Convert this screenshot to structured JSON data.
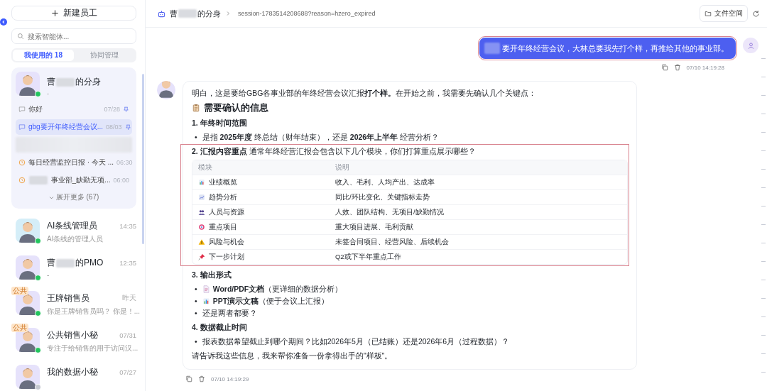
{
  "sidebar": {
    "new_button": "新建员工",
    "search": {
      "placeholder": "搜索智能体..."
    },
    "tabs": [
      {
        "label": "我使用的",
        "count": "18",
        "selected": true
      },
      {
        "label": "协同管理",
        "selected": false
      }
    ],
    "current_agent": {
      "name": [
        "曹",
        "的分身"
      ],
      "subtitle": "-",
      "online": true,
      "sessions": [
        {
          "kind": "chat",
          "title": "你好",
          "time": "07/28",
          "pinned": true,
          "selected": false,
          "redacted": false
        },
        {
          "kind": "chat",
          "title": "gbg要开年终经营会议...",
          "time": "08/03",
          "pinned": true,
          "selected": true,
          "redacted": false
        },
        {
          "kind": "hidden"
        },
        {
          "kind": "scheduled",
          "title": "每日经营监控日报 · 今天 ...",
          "time": "06:30",
          "selected": false,
          "redacted": false
        },
        {
          "kind": "scheduled",
          "title": "事业部_缺勤无项...",
          "time": "06:00",
          "selected": false,
          "redacted": true
        }
      ],
      "expand": "展开更多 (67)"
    },
    "agents": [
      {
        "name": [
          "AI条线管理员"
        ],
        "desc": "AI条线的管理人员",
        "time": "14:35",
        "online": true,
        "color": "#d5eef8"
      },
      {
        "name": [
          "曹",
          "的PMO"
        ],
        "desc": "-",
        "time": "12:35",
        "online": true,
        "color": "#e6e2fb"
      },
      {
        "name": [
          "王牌销售员"
        ],
        "desc": "你是王牌销售员吗？ 你是！...",
        "time": "昨天",
        "tag": "公共",
        "online": true,
        "color": "#e6e2fb"
      },
      {
        "name": [
          "公共销售小秘"
        ],
        "desc": "专注于给销售的用于访问汉...",
        "time": "07/31",
        "tag": "公共",
        "online": true,
        "color": "#e6e2fb"
      },
      {
        "name": [
          "我的数据小秘"
        ],
        "time": "07/27",
        "online": false,
        "color": "#e6e2fb"
      }
    ]
  },
  "header": {
    "agent": [
      "曹",
      "的分身"
    ],
    "session": "session-1783514208688?reason=hzero_expired",
    "files_button": "文件空间"
  },
  "user_message": {
    "redacted_prefix": true,
    "text": "要开年终经营会议，大林总要我先打个样，再推给其他的事业部。",
    "time": "07/10 14:19:28",
    "highlighted": true
  },
  "bot_message": {
    "intro": "明白，这是要给GBG各事业部的年终经营会议汇报**打个样。**在开始之前，我需要先确认几个关键点：",
    "heading": "需要确认的信息",
    "sections": [
      {
        "title": "1. 年终时间范围",
        "highlighted": false,
        "bullets": [
          {
            "kind": "text",
            "marker": "•",
            "text": "是指 **2025年度** 终总结（财年结束），还是 **2026年上半年** 经营分析？"
          }
        ]
      },
      {
        "title": "2. 汇报内容重点",
        "note": "通常年终经营汇报会包含以下几个模块，你们打算重点展示哪些？",
        "highlighted": true,
        "table": {
          "columns": [
            "模块",
            "说明"
          ],
          "rows": [
            [
              "业绩概览",
              "收入、毛利、人均产出、达成率"
            ],
            [
              "趋势分析",
              "同比/环比变化、关键指标走势"
            ],
            [
              "人员与资源",
              "人效、团队结构、无项目/缺勤情况"
            ],
            [
              "重点项目",
              "重大项目进展、毛利贡献"
            ],
            [
              "风险与机会",
              "未签合同项目、经营风险、后续机会"
            ],
            [
              "下一步计划",
              "Q2或下半年重点工作"
            ]
          ]
        }
      },
      {
        "title": "3. 输出形式",
        "highlighted": false,
        "bullets": [
          {
            "kind": "document",
            "marker": "•",
            "text": "**Word/PDF文档**（更详细的数据分析）"
          },
          {
            "kind": "presentation",
            "marker": "•",
            "text": "**PPT演示文稿**（便于会议上汇报）"
          },
          {
            "kind": "text",
            "marker": "•",
            "text": "还是两者都要？"
          }
        ]
      },
      {
        "title": "4. 数据截止时间",
        "highlighted": false,
        "bullets": [
          {
            "kind": "text",
            "marker": "•",
            "text": "报表数据希望截止到哪个期间？比如2026年5月（已结账）还是2026年6月（过程数据）？"
          }
        ]
      }
    ],
    "closing": "请告诉我这些信息，我来帮你准备一份拿得出手的\"样板\"。",
    "time": "07/10 14:19:29"
  }
}
